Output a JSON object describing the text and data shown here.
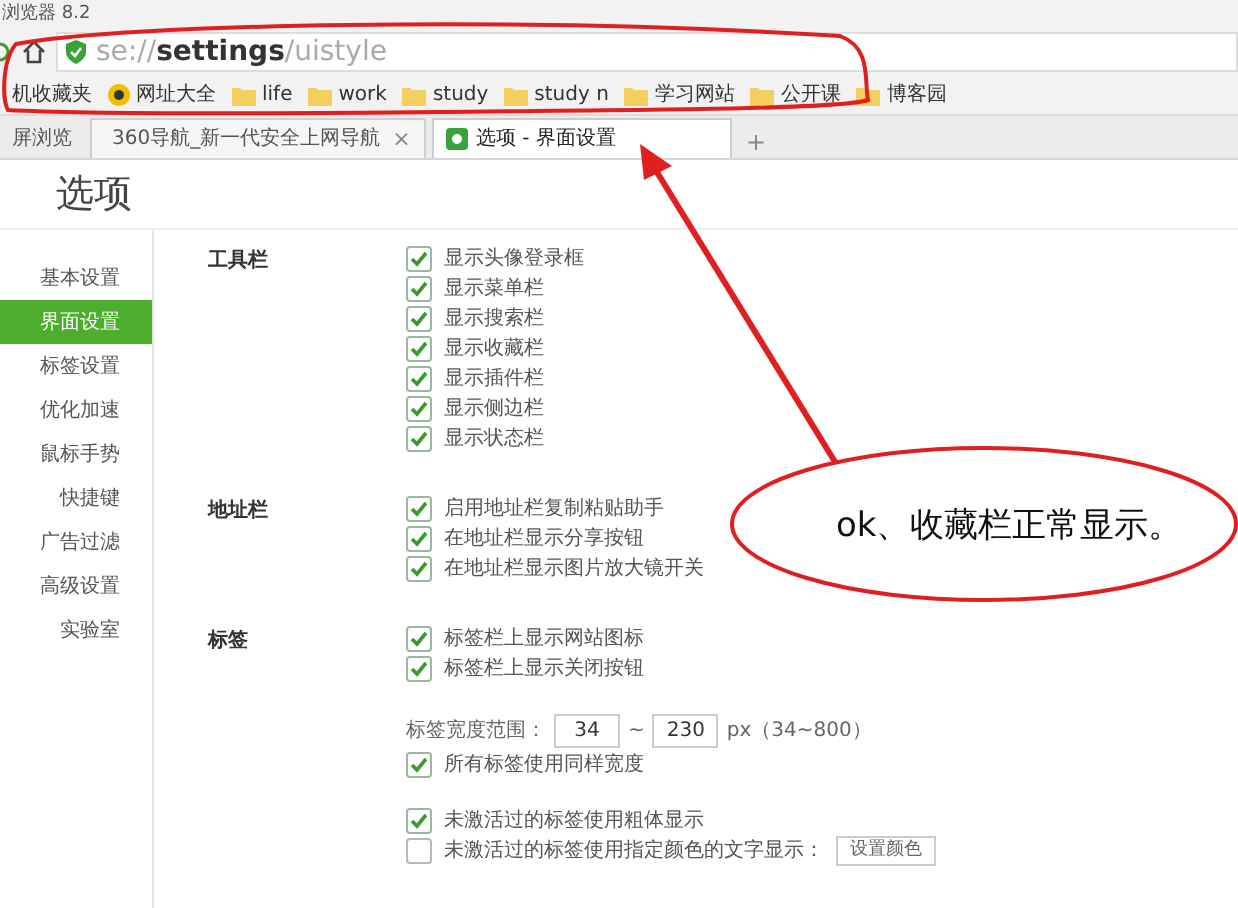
{
  "window": {
    "title": "浏览器 8.2"
  },
  "address_bar": {
    "scheme": "se://",
    "host": "settings",
    "path": "/uistyle"
  },
  "bookmarks": [
    {
      "label": "机收藏夹",
      "kind": "text"
    },
    {
      "label": "网址大全",
      "kind": "site"
    },
    {
      "label": "life",
      "kind": "folder"
    },
    {
      "label": "work",
      "kind": "folder"
    },
    {
      "label": "study",
      "kind": "folder"
    },
    {
      "label": "study n",
      "kind": "folder"
    },
    {
      "label": "学习网站",
      "kind": "folder"
    },
    {
      "label": "公开课",
      "kind": "folder"
    },
    {
      "label": "博客园",
      "kind": "folder"
    }
  ],
  "tabs": [
    {
      "label": "屏浏览",
      "kind": "mode",
      "selected": false
    },
    {
      "label": "360导航_新一代安全上网导航",
      "kind": "site",
      "selected": false,
      "close": "×"
    },
    {
      "label": "选项 - 界面设置",
      "kind": "settings",
      "selected": true
    }
  ],
  "new_tab": "+",
  "page_title": "选项",
  "sidebar": {
    "items": [
      {
        "label": "基本设置",
        "selected": false
      },
      {
        "label": "界面设置",
        "selected": true
      },
      {
        "label": "标签设置",
        "selected": false
      },
      {
        "label": "优化加速",
        "selected": false
      },
      {
        "label": "鼠标手势",
        "selected": false
      },
      {
        "label": "快捷键",
        "selected": false
      },
      {
        "label": "广告过滤",
        "selected": false
      },
      {
        "label": "高级设置",
        "selected": false
      },
      {
        "label": "实验室",
        "selected": false
      }
    ]
  },
  "sections": [
    {
      "title": "工具栏",
      "rows": [
        {
          "kind": "checkbox",
          "label": "显示头像登录框",
          "checked": true
        },
        {
          "kind": "checkbox",
          "label": "显示菜单栏",
          "checked": true
        },
        {
          "kind": "checkbox",
          "label": "显示搜索栏",
          "checked": true
        },
        {
          "kind": "checkbox",
          "label": "显示收藏栏",
          "checked": true
        },
        {
          "kind": "checkbox",
          "label": "显示插件栏",
          "checked": true
        },
        {
          "kind": "checkbox",
          "label": "显示侧边栏",
          "checked": true
        },
        {
          "kind": "checkbox",
          "label": "显示状态栏",
          "checked": true
        }
      ]
    },
    {
      "title": "地址栏",
      "rows": [
        {
          "kind": "checkbox",
          "label": "启用地址栏复制粘贴助手",
          "checked": true
        },
        {
          "kind": "checkbox",
          "label": "在地址栏显示分享按钮",
          "checked": true
        },
        {
          "kind": "checkbox",
          "label": "在地址栏显示图片放大镜开关",
          "checked": true
        }
      ]
    },
    {
      "title": "标签",
      "rows": [
        {
          "kind": "checkbox",
          "label": "标签栏上显示网站图标",
          "checked": true
        },
        {
          "kind": "checkbox",
          "label": "标签栏上显示关闭按钮",
          "checked": true
        },
        {
          "kind": "range",
          "label": "标签宽度范围：",
          "min": "34",
          "sep": "~",
          "max": "230",
          "unit": "px（34~800）"
        },
        {
          "kind": "checkbox",
          "label": "所有标签使用同样宽度",
          "checked": true
        },
        {
          "kind": "checkbox",
          "label": "未激活过的标签使用粗体显示",
          "checked": true
        },
        {
          "kind": "checkbox",
          "label": "未激活过的标签使用指定颜色的文字显示：",
          "checked": false,
          "button": "设置颜色"
        }
      ]
    }
  ],
  "annotation": {
    "text": "ok、收藏栏正常显示。"
  }
}
